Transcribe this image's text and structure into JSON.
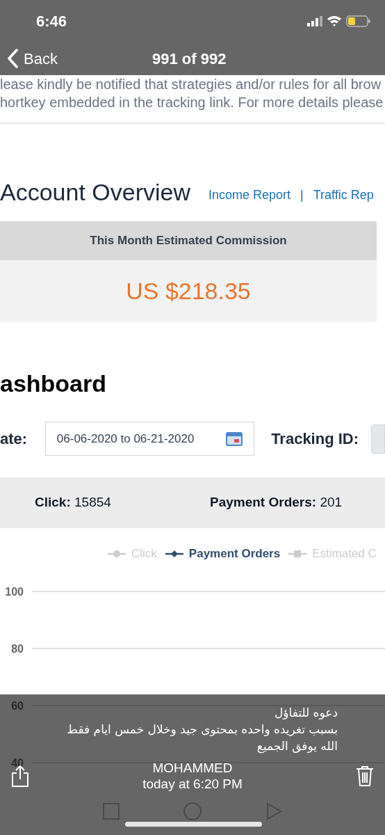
{
  "status_bar": {
    "time": "6:46"
  },
  "nav": {
    "back": "Back",
    "title": "991 of 992"
  },
  "notice": {
    "lines": [
      "lease kindly be notified that strategies and/or rules for all brow",
      "hortkey embedded in the tracking link. For more details please"
    ]
  },
  "overview": {
    "title": "Account Overview",
    "links": [
      "Income Report",
      "Traffic Rep"
    ],
    "separator": "|"
  },
  "commission": {
    "label": "This Month Estimated Commission",
    "value": "US $218.35"
  },
  "dashboard": {
    "title": "ashboard",
    "date_label": "ate:",
    "date_value": "06-06-2020 to 06-21-2020",
    "tracking_label": "Tracking ID:"
  },
  "stats": [
    {
      "label": "Click:",
      "value": "15854"
    },
    {
      "label": "Payment Orders:",
      "value": "201"
    }
  ],
  "chart": {
    "legend": [
      {
        "kind": "circle",
        "visible": false
      },
      {
        "kind": "diamond",
        "visible": true
      },
      {
        "kind": "square",
        "visible": false
      }
    ],
    "chart_data": {
      "type": "line",
      "ylim": [
        40,
        100
      ],
      "yticks": [
        40,
        60,
        80,
        100
      ],
      "series": [
        {
          "name": "Click",
          "color": "#c8c8c8"
        },
        {
          "name": "Payment Orders",
          "color": "#2f4d6b"
        },
        {
          "name": "Estimated C",
          "color": "#c8c8c8"
        }
      ]
    }
  },
  "caption": {
    "lines": [
      "دعوه للتفاؤل",
      "بسبب تغريده واحده بمحتوى جيد وخلال خمس ايام فقط",
      "الله يوفق الجميع"
    ]
  },
  "photo_info": {
    "sender": "MOHAMMED",
    "time": "today at 6:20 PM"
  }
}
